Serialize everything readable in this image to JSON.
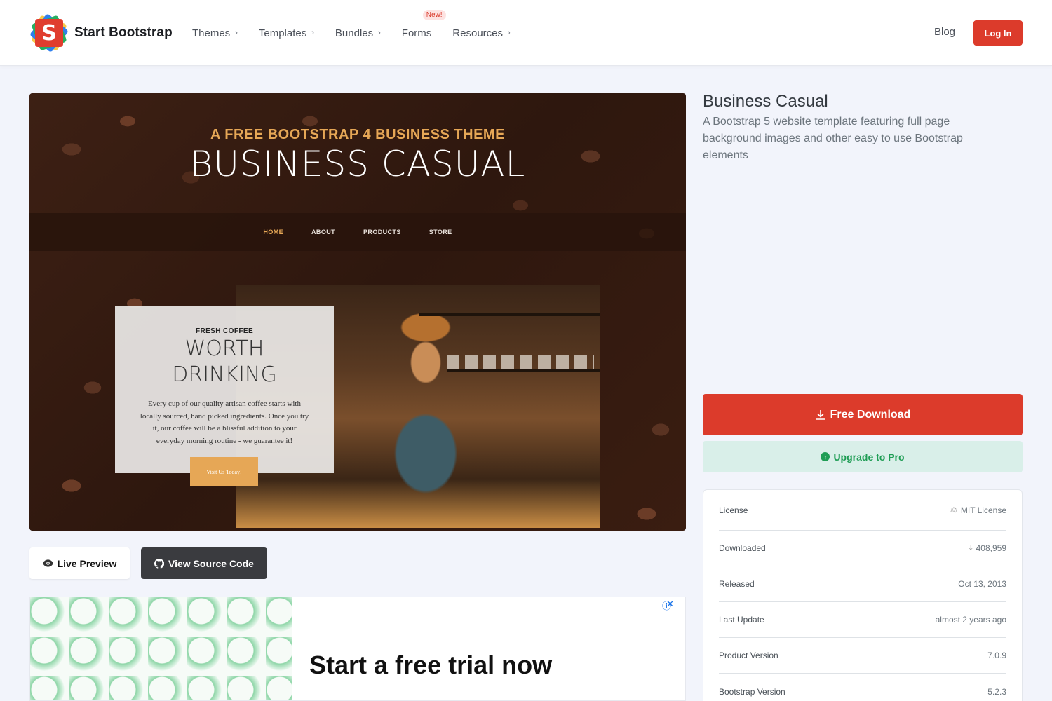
{
  "brand": {
    "name": "Start Bootstrap",
    "logo_letter": "S"
  },
  "nav": {
    "items": [
      {
        "label": "Themes",
        "icon": "chevron-right-icon"
      },
      {
        "label": "Templates",
        "icon": "chevron-right-icon"
      },
      {
        "label": "Bundles",
        "icon": "chevron-right-icon"
      },
      {
        "label": "Forms",
        "badge": "New!"
      },
      {
        "label": "Resources",
        "icon": "chevron-right-icon"
      }
    ],
    "blog": "Blog",
    "login": "Log In"
  },
  "preview": {
    "subtitle": "A FREE BOOTSTRAP 4 BUSINESS THEME",
    "title": "BUSINESS CASUAL",
    "nav": [
      "HOME",
      "ABOUT",
      "PRODUCTS",
      "STORE"
    ],
    "card": {
      "kicker": "FRESH COFFEE",
      "heading_line1": "WORTH",
      "heading_line2": "DRINKING",
      "body": "Every cup of our quality artisan coffee starts with locally sourced, hand picked ingredients. Once you try it, our coffee will be a blissful addition to your everyday morning routine - we guarantee it!",
      "button": "Visit Us Today!"
    }
  },
  "actions": {
    "live_preview": "Live Preview",
    "view_source": "View Source Code"
  },
  "ad": {
    "headline": "Start a free trial now"
  },
  "product": {
    "title": "Business Casual",
    "description": "A Bootstrap 5 website template featuring full page background images and other easy to use Bootstrap elements",
    "download": "Free Download",
    "upgrade": "Upgrade to Pro"
  },
  "info": [
    {
      "label": "License",
      "value": "MIT License",
      "icon": "license-icon"
    },
    {
      "label": "Downloaded",
      "value": "408,959",
      "icon": "download-icon"
    },
    {
      "label": "Released",
      "value": "Oct 13, 2013"
    },
    {
      "label": "Last Update",
      "value": "almost 2 years ago"
    },
    {
      "label": "Product Version",
      "value": "7.0.9"
    },
    {
      "label": "Bootstrap Version",
      "value": "5.2.3"
    }
  ],
  "colors": {
    "accent": "#dc3b2b",
    "pro": "#1f9d55",
    "pro_bg": "#d9efe9",
    "preview_accent": "#e6a756"
  }
}
